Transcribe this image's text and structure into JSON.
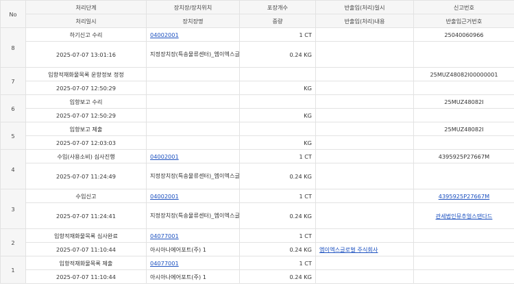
{
  "header": {
    "no": "No",
    "stage": "처리단계",
    "location": "장치장/장치위치",
    "packages": "포장개수",
    "inout_datetime": "반출입(처리)일시",
    "report_no": "신고번호",
    "proc_datetime": "처리일시",
    "location_name": "장치장명",
    "weight": "중량",
    "inout_content": "반출입(처리)내용",
    "inout_basis_no": "반출입근거번호"
  },
  "rows": [
    {
      "no": "8",
      "stage": "하기신고 수리",
      "location_code": "04002001",
      "packages": "1 CT",
      "inout_datetime": "",
      "report_no": "25040060966",
      "proc_datetime": "2025-07-07 13:01:16",
      "location_name": "지정장치장(특송물류센터)_엠이엑스글로벌 주식회사",
      "weight": "0.24 KG",
      "inout_content": "",
      "basis_no": ""
    },
    {
      "no": "7",
      "stage": "입항적재화물목록 운항정보 정정",
      "location_code": "",
      "packages": "",
      "inout_datetime": "",
      "report_no": "25MUZ48082I00000001",
      "proc_datetime": "2025-07-07 12:50:29",
      "location_name": "",
      "weight": "KG",
      "inout_content": "",
      "basis_no": ""
    },
    {
      "no": "6",
      "stage": "입항보고 수리",
      "location_code": "",
      "packages": "",
      "inout_datetime": "",
      "report_no": "25MUZ48082I",
      "proc_datetime": "2025-07-07 12:50:29",
      "location_name": "",
      "weight": "KG",
      "inout_content": "",
      "basis_no": ""
    },
    {
      "no": "5",
      "stage": "입항보고 제출",
      "location_code": "",
      "packages": "",
      "inout_datetime": "",
      "report_no": "25MUZ48082I",
      "proc_datetime": "2025-07-07 12:03:03",
      "location_name": "",
      "weight": "KG",
      "inout_content": "",
      "basis_no": ""
    },
    {
      "no": "4",
      "stage": "수입(사용소비) 심사진행",
      "location_code": "04002001",
      "packages": "1 CT",
      "inout_datetime": "",
      "report_no": "4395925P27667M",
      "proc_datetime": "2025-07-07 11:24:49",
      "location_name": "지정장치장(특송물류센터)_엠이엑스글로벌 주식회사",
      "weight": "0.24 KG",
      "inout_content": "",
      "basis_no": ""
    },
    {
      "no": "3",
      "stage": "수입신고",
      "location_code": "04002001",
      "packages": "1 CT",
      "inout_datetime": "",
      "report_no": "4395925P27667M",
      "proc_datetime": "2025-07-07 11:24:41",
      "location_name": "지정장치장(특송물류센터)_엠이엑스글로벌 주식회사",
      "weight": "0.24 KG",
      "inout_content": "",
      "basis_no": "관세법인뮤추얼스탠다드"
    },
    {
      "no": "2",
      "stage": "입항적재화물목록 심사완료",
      "location_code": "04077001",
      "packages": "1 CT",
      "inout_datetime": "",
      "report_no": "",
      "proc_datetime": "2025-07-07 11:10:44",
      "location_name": "아시아나에어포트(주) 1",
      "weight": "0.24 KG",
      "inout_content": "엠이엑스글로벌 주식회사",
      "basis_no": ""
    },
    {
      "no": "1",
      "stage": "입항적재화물목록 제출",
      "location_code": "04077001",
      "packages": "1 CT",
      "inout_datetime": "",
      "report_no": "",
      "proc_datetime": "2025-07-07 11:10:44",
      "location_name": "아시아나에어포트(주) 1",
      "weight": "0.24 KG",
      "inout_content": "",
      "basis_no": ""
    }
  ]
}
